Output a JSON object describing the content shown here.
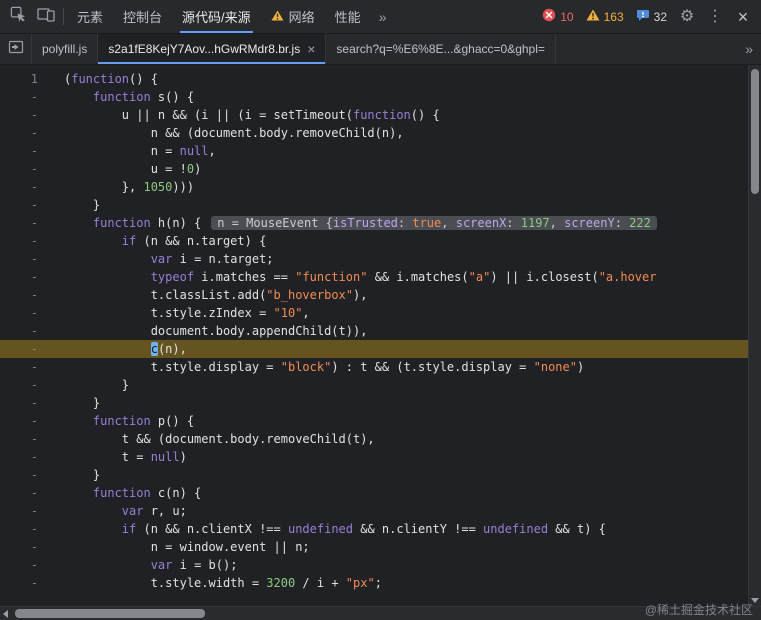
{
  "toolbar": {
    "tabs": [
      {
        "label": "元素"
      },
      {
        "label": "控制台"
      },
      {
        "label": "源代码/来源"
      },
      {
        "label": "网络"
      },
      {
        "label": "性能"
      }
    ],
    "error_count": "10",
    "warning_count": "163",
    "issue_count": "32"
  },
  "file_tabs": [
    {
      "label": "polyfill.js"
    },
    {
      "label": "s2a1fE8KejY7Aov...hGwRMdr8.br.js"
    },
    {
      "label": "search?q=%E6%8E...&ghacc=0&ghpl="
    }
  ],
  "icons": {
    "settings_gear": "⚙",
    "kebab_menu": "⋮",
    "close_devtools": "×",
    "tab_close": "×",
    "overflow_chevron": "»"
  },
  "editor": {
    "preview": [
      [
        "p",
        "n = MouseEvent {"
      ],
      [
        "pr",
        "isTrusted"
      ],
      [
        "p",
        ": "
      ],
      [
        "b",
        "true"
      ],
      [
        "p",
        ", "
      ],
      [
        "pr",
        "screenX"
      ],
      [
        "p",
        ": "
      ],
      [
        "nm",
        "1197"
      ],
      [
        "p",
        ", "
      ],
      [
        "pr",
        "screenY"
      ],
      [
        "p",
        ": "
      ],
      [
        "nm",
        "222"
      ]
    ],
    "lines": [
      {
        "g": "1",
        "t": [
          [
            "p",
            "("
          ],
          [
            "k",
            "function"
          ],
          [
            "p",
            "() {"
          ]
        ]
      },
      {
        "g": "-",
        "t": [
          [
            "p",
            "    "
          ],
          [
            "k",
            "function"
          ],
          [
            "p",
            " s() {"
          ]
        ]
      },
      {
        "g": "-",
        "t": [
          [
            "p",
            "        u || n && (i || (i = setTimeout("
          ],
          [
            "k",
            "function"
          ],
          [
            "p",
            "() {"
          ]
        ]
      },
      {
        "g": "-",
        "t": [
          [
            "p",
            "            n && (document.body.removeChild(n),"
          ]
        ]
      },
      {
        "g": "-",
        "t": [
          [
            "p",
            "            n = "
          ],
          [
            "a",
            "null"
          ],
          [
            "p",
            ","
          ]
        ]
      },
      {
        "g": "-",
        "t": [
          [
            "p",
            "            u = !"
          ],
          [
            "n",
            "0"
          ],
          [
            "p",
            ")"
          ]
        ]
      },
      {
        "g": "-",
        "t": [
          [
            "p",
            "        }, "
          ],
          [
            "n",
            "1050"
          ],
          [
            "p",
            ")))"
          ]
        ]
      },
      {
        "g": "-",
        "t": [
          [
            "p",
            "    }"
          ]
        ]
      },
      {
        "g": "-",
        "preview": true,
        "t": [
          [
            "p",
            "    "
          ],
          [
            "k",
            "function"
          ],
          [
            "p",
            " h(n) {"
          ]
        ]
      },
      {
        "g": "-",
        "t": [
          [
            "p",
            "        "
          ],
          [
            "k",
            "if"
          ],
          [
            "p",
            " (n && n.target) {"
          ]
        ]
      },
      {
        "g": "-",
        "t": [
          [
            "p",
            "            "
          ],
          [
            "k",
            "var"
          ],
          [
            "p",
            " i = n.target;"
          ]
        ]
      },
      {
        "g": "-",
        "t": [
          [
            "p",
            "            "
          ],
          [
            "k",
            "typeof"
          ],
          [
            "p",
            " i.matches == "
          ],
          [
            "s",
            "\"function\""
          ],
          [
            "p",
            " && i.matches("
          ],
          [
            "s",
            "\"a\""
          ],
          [
            "p",
            ") || i.closest("
          ],
          [
            "s",
            "\"a.hover"
          ]
        ]
      },
      {
        "g": "-",
        "t": [
          [
            "p",
            "            t.classList.add("
          ],
          [
            "s",
            "\"b_hoverbox\""
          ],
          [
            "p",
            "),"
          ]
        ]
      },
      {
        "g": "-",
        "t": [
          [
            "p",
            "            t.style.zIndex = "
          ],
          [
            "s",
            "\"10\""
          ],
          [
            "p",
            ","
          ]
        ]
      },
      {
        "g": "-",
        "t": [
          [
            "p",
            "            document.body.appendChild(t)),"
          ]
        ]
      },
      {
        "g": "-",
        "exec": true,
        "t": [
          [
            "p",
            "            "
          ],
          [
            "x",
            "c"
          ],
          [
            "p",
            "(n),"
          ]
        ]
      },
      {
        "g": "-",
        "t": [
          [
            "p",
            "            t.style.display = "
          ],
          [
            "s",
            "\"block\""
          ],
          [
            "p",
            ") : t && (t.style.display = "
          ],
          [
            "s",
            "\"none\""
          ],
          [
            "p",
            ")"
          ]
        ]
      },
      {
        "g": "-",
        "t": [
          [
            "p",
            "        }"
          ]
        ]
      },
      {
        "g": "-",
        "t": [
          [
            "p",
            "    }"
          ]
        ]
      },
      {
        "g": "-",
        "t": [
          [
            "p",
            "    "
          ],
          [
            "k",
            "function"
          ],
          [
            "p",
            " p() {"
          ]
        ]
      },
      {
        "g": "-",
        "t": [
          [
            "p",
            "        t && (document.body.removeChild(t),"
          ]
        ]
      },
      {
        "g": "-",
        "t": [
          [
            "p",
            "        t = "
          ],
          [
            "a",
            "null"
          ],
          [
            "p",
            ")"
          ]
        ]
      },
      {
        "g": "-",
        "t": [
          [
            "p",
            "    }"
          ]
        ]
      },
      {
        "g": "-",
        "t": [
          [
            "p",
            "    "
          ],
          [
            "k",
            "function"
          ],
          [
            "p",
            " c(n) {"
          ]
        ]
      },
      {
        "g": "-",
        "t": [
          [
            "p",
            "        "
          ],
          [
            "k",
            "var"
          ],
          [
            "p",
            " r, u;"
          ]
        ]
      },
      {
        "g": "-",
        "t": [
          [
            "p",
            "        "
          ],
          [
            "k",
            "if"
          ],
          [
            "p",
            " (n && n.clientX !== "
          ],
          [
            "a",
            "undefined"
          ],
          [
            "p",
            " && n.clientY !== "
          ],
          [
            "a",
            "undefined"
          ],
          [
            "p",
            " && t) {"
          ]
        ]
      },
      {
        "g": "-",
        "t": [
          [
            "p",
            "            n = window.event || n;"
          ]
        ]
      },
      {
        "g": "-",
        "t": [
          [
            "p",
            "            "
          ],
          [
            "k",
            "var"
          ],
          [
            "p",
            " i = b();"
          ]
        ]
      },
      {
        "g": "-",
        "t": [
          [
            "p",
            "            t.style.width = "
          ],
          [
            "n",
            "3200"
          ],
          [
            "p",
            " / i + "
          ],
          [
            "s",
            "\"px\""
          ],
          [
            "p",
            ";"
          ]
        ]
      }
    ]
  },
  "watermark": "@稀土掘金技术社区",
  "colors": {
    "accent": "#669df6",
    "error": "#e05252",
    "warning": "#f0b13e",
    "issues": "#4e8ddb",
    "execution_line_bg": "#665420",
    "keyword": "#9a7fd5",
    "string": "#f28b54",
    "number": "#8fc97e",
    "background": "#202124"
  }
}
